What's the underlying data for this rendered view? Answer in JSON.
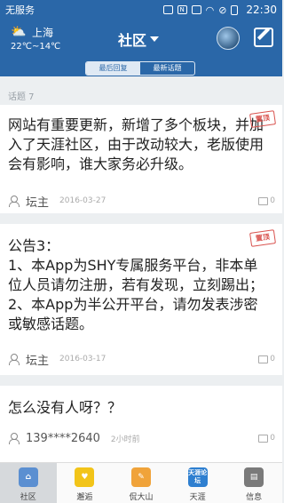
{
  "status_bar": {
    "carrier": "无服务",
    "time": "22:30",
    "icons": [
      "image-icon",
      "nfc-icon",
      "vibrate-icon",
      "wifi-icon",
      "no-sim-icon",
      "battery-icon"
    ]
  },
  "header": {
    "city": "上海",
    "temperature": "22℃~14℃",
    "weather_icon": "partly-cloudy-icon",
    "title": "社区"
  },
  "tabs": [
    {
      "label": "最后回复",
      "active": true
    },
    {
      "label": "最新话题",
      "active": false
    }
  ],
  "topic_count": "话题 7",
  "posts": [
    {
      "text": "网站有重要更新，新增了多个板块，并加入了天涯社区，由于改动较大，老版使用会有影响，谁大家务必升级。",
      "pinned_label": "置顶",
      "author": "坛主",
      "date": "2016-03-27",
      "comments": "0"
    },
    {
      "text": "公告3：\n1、本App为SHY专属服务平台，非本单位人员请勿注册，若有发现，立刻踢出；\n2、本App为半公开平台，请勿发表涉密或敏感话题。",
      "pinned_label": "置顶",
      "author": "坛主",
      "date": "2016-03-17",
      "comments": "0"
    },
    {
      "text": "怎么没有人呀？？",
      "author": "139****2640",
      "date": "2小时前",
      "comments": "0"
    }
  ],
  "bottom_nav": [
    {
      "label": "社区",
      "icon": "home-icon",
      "color": "#5b8fd1",
      "active": true
    },
    {
      "label": "邂逅",
      "icon": "heart-icon",
      "color": "#f2c419",
      "active": false
    },
    {
      "label": "侃大山",
      "icon": "edit-icon",
      "color": "#f0a33a",
      "active": false
    },
    {
      "label": "天涯",
      "icon": "tianya-forum-icon",
      "icon_text": "天涯论坛",
      "color": "#2e7fd0",
      "active": false
    },
    {
      "label": "信息",
      "icon": "message-icon",
      "color": "#7a7a7a",
      "active": false
    }
  ],
  "colors": {
    "primary": "#2a67a8",
    "pinned": "#d9534f"
  }
}
